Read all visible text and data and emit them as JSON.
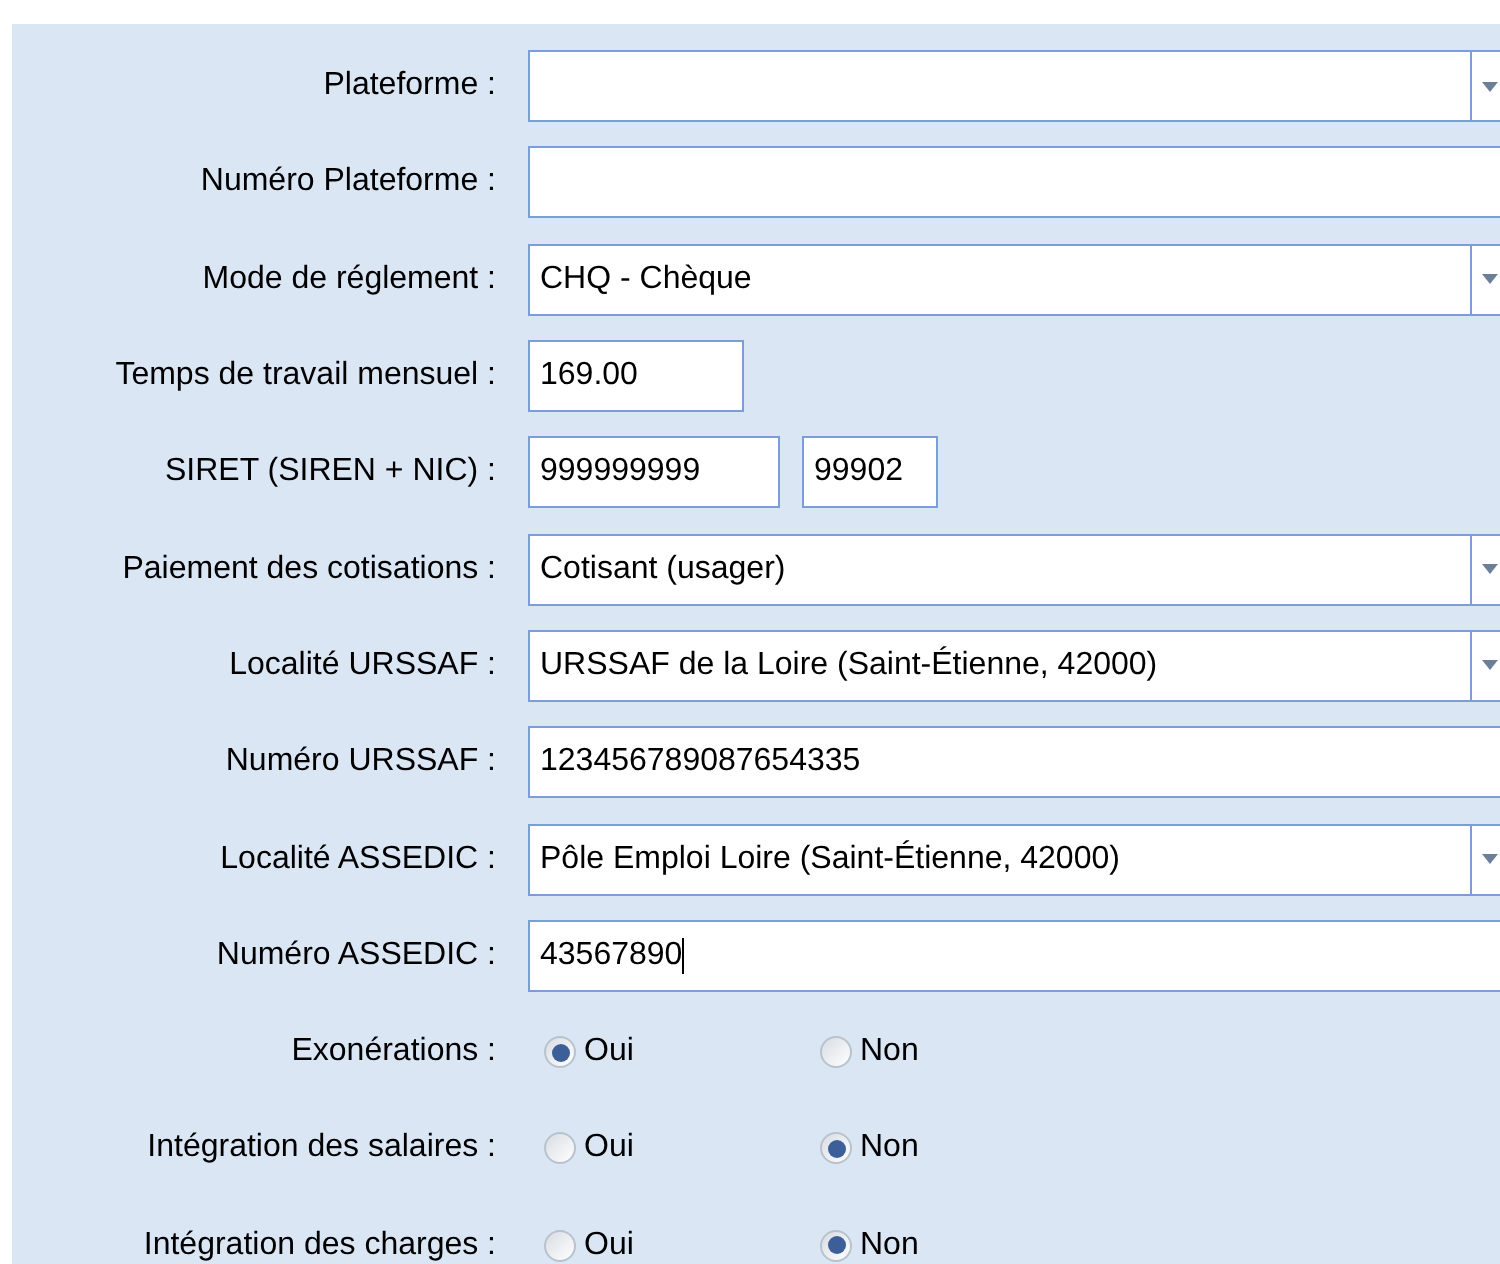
{
  "rows": [
    {
      "label": "Plateforme :",
      "kind": "select",
      "value": ""
    },
    {
      "label": "Numéro Plateforme :",
      "kind": "text",
      "value": ""
    },
    {
      "label": "Mode de réglement :",
      "kind": "select",
      "value": "CHQ - Chèque"
    },
    {
      "label": "Temps de travail mensuel :",
      "kind": "short",
      "value": "169.00"
    },
    {
      "label": "SIRET (SIREN + NIC) :",
      "kind": "pair",
      "values": [
        "999999999",
        "99902"
      ]
    },
    {
      "label": "Paiement des cotisations :",
      "kind": "select",
      "value": "Cotisant (usager)"
    },
    {
      "label": "Localité URSSAF :",
      "kind": "select",
      "value": "URSSAF de la Loire (Saint-Étienne, 42000)"
    },
    {
      "label": "Numéro URSSAF :",
      "kind": "text",
      "value": "123456789087654335"
    },
    {
      "label": "Localité ASSEDIC :",
      "kind": "select",
      "value": "Pôle Emploi Loire (Saint-Étienne, 42000)"
    },
    {
      "label": "Numéro ASSEDIC :",
      "kind": "text",
      "value": "43567890",
      "focused": true
    },
    {
      "label": "Exonérations :",
      "kind": "radio",
      "options": [
        {
          "label": "Oui",
          "selected": true
        },
        {
          "label": "Non",
          "selected": false
        }
      ]
    },
    {
      "label": "Intégration des salaires :",
      "kind": "radio",
      "options": [
        {
          "label": "Oui",
          "selected": false
        },
        {
          "label": "Non",
          "selected": true
        }
      ]
    },
    {
      "label": "Intégration des charges :",
      "kind": "radio",
      "options": [
        {
          "label": "Oui",
          "selected": false
        },
        {
          "label": "Non",
          "selected": true
        }
      ]
    }
  ]
}
